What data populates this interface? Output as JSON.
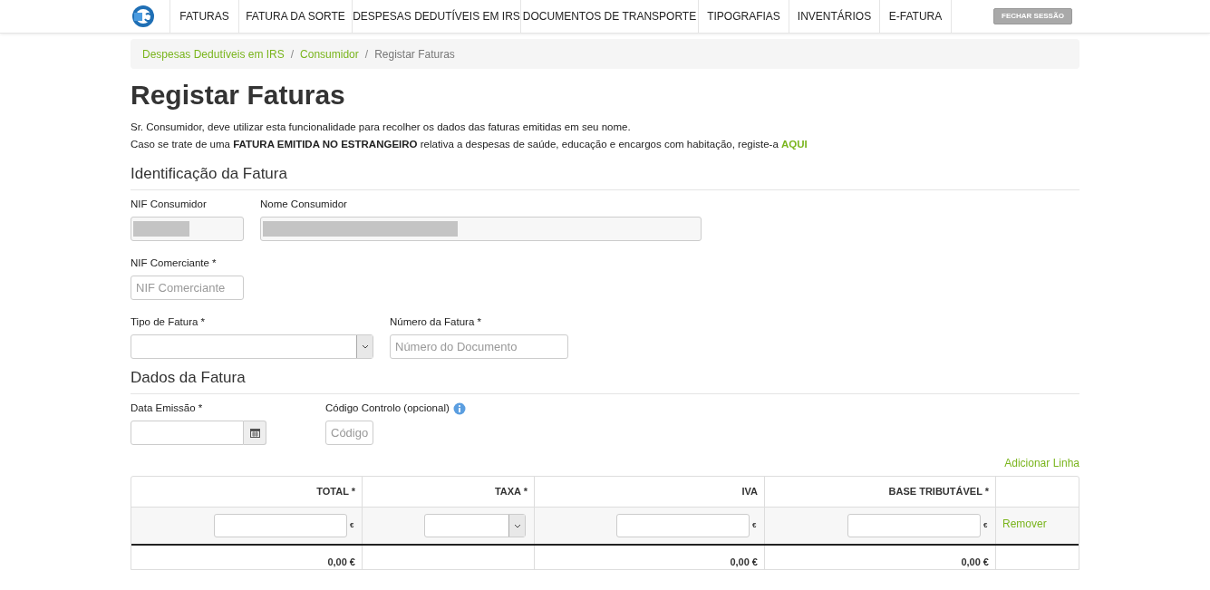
{
  "nav": {
    "items": [
      {
        "label": "FATURAS"
      },
      {
        "label": "FATURA DA SORTE"
      },
      {
        "label": "DESPESAS DEDUTÍVEIS EM IRS"
      },
      {
        "label": "DOCUMENTOS DE TRANSPORTE"
      },
      {
        "label": "TIPOGRAFIAS"
      },
      {
        "label": "INVENTÁRIOS"
      },
      {
        "label": "E-FATURA"
      }
    ],
    "logout": "FECHAR SESSÃO"
  },
  "breadcrumb": [
    {
      "label": "Despesas Dedutíveis em IRS",
      "kind": "link"
    },
    {
      "label": "Consumidor",
      "kind": "link"
    },
    {
      "label": "Registar Faturas",
      "kind": "current"
    }
  ],
  "breadcrumb_separators": [
    "/",
    "/"
  ],
  "title": "Registar Faturas",
  "intro": [
    "Sr. Consumidor, deve utilizar esta funcionalidade para recolher os dados das faturas emitidas em seu nome.",
    "Caso se trate de uma **FATURA EMITIDA NO ESTRANGEIRO** relativa a despesas de saúde, educação e encargos com habitação, registe-a"
  ],
  "intro_link": "AQUI",
  "sections": [
    {
      "title": "Identificação da Fatura",
      "rows": [
        [
          {
            "label": "NIF Consumidor",
            "kind": "redacted"
          },
          {
            "label": "Nome Consumidor",
            "kind": "redacted"
          }
        ],
        [
          {
            "label": "NIF Comerciante *",
            "kind": "text",
            "placeholder": "NIF Comerciante"
          }
        ],
        [
          {
            "label": "Tipo de Fatura *",
            "kind": "select"
          },
          {
            "label": "Número da Fatura *",
            "kind": "text",
            "placeholder": "Número do Documento"
          }
        ]
      ]
    },
    {
      "title": "Dados da Fatura",
      "rows": [
        [
          {
            "label": "Data Emissão *",
            "kind": "date"
          },
          {
            "label": "Código Controlo (opcional)",
            "kind": "text",
            "placeholder": "Código",
            "info": true
          }
        ]
      ]
    }
  ],
  "add_line": "Adicionar Linha",
  "table": {
    "columns": [
      {
        "label": "TOTAL *",
        "kind": "input",
        "unit": "€",
        "total": "0,00 €"
      },
      {
        "label": "TAXA *",
        "kind": "select"
      },
      {
        "label": "IVA",
        "kind": "input",
        "unit": "€",
        "total": "0,00 €"
      },
      {
        "label": "BASE TRIBUTÁVEL *",
        "kind": "input",
        "unit": "€",
        "total": "0,00 €"
      }
    ],
    "remove": "Remover"
  }
}
